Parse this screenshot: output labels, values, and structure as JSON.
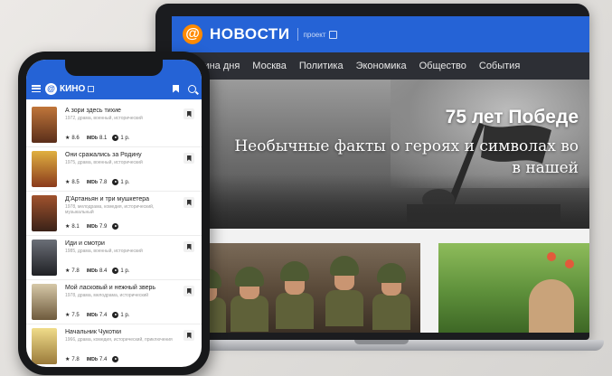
{
  "news": {
    "logo_symbol": "@",
    "title": "НОВОСТИ",
    "project_label": "проект",
    "nav": [
      "Картина дня",
      "Москва",
      "Политика",
      "Экономика",
      "Общество",
      "События"
    ],
    "hero_title": "75 лет Победе",
    "hero_subtitle_line1": "Необычные факты о героях и символах во",
    "hero_subtitle_line2": "в нашей",
    "colors": {
      "header": "#2563d6",
      "nav": "#2d2f35",
      "logo": "#ff8a00"
    }
  },
  "kino": {
    "logo_symbol": "@",
    "title": "КИНО",
    "header_icons": [
      "menu-icon",
      "bookmark-icon",
      "search-icon"
    ],
    "imdb_label": "IMDb",
    "movies": [
      {
        "title": "А зори здесь тихие",
        "meta": "1972, драма, военный, исторический",
        "rating": "8.6",
        "imdb": "8.1",
        "seasons": "1 р.",
        "poster_color": "#8a4b2a"
      },
      {
        "title": "Они сражались за Родину",
        "meta": "1975, драма, военный, исторический",
        "rating": "8.5",
        "imdb": "7.8",
        "seasons": "1 р.",
        "poster_color": "#c8922c"
      },
      {
        "title": "Д'Артаньян и три мушкетера",
        "meta": "1978, мелодрама, комедия, исторический, музыкальный",
        "rating": "8.1",
        "imdb": "7.9",
        "seasons": "",
        "poster_color": "#6a3a2a"
      },
      {
        "title": "Иди и смотри",
        "meta": "1985, драма, военный, исторический",
        "rating": "7.8",
        "imdb": "8.4",
        "seasons": "1 р.",
        "poster_color": "#3d3f44"
      },
      {
        "title": "Мой ласковый и нежный зверь",
        "meta": "1978, драма, мелодрама, исторический",
        "rating": "7.5",
        "imdb": "7.4",
        "seasons": "1 р.",
        "poster_color": "#9b8a6a"
      },
      {
        "title": "Начальник Чукотки",
        "meta": "1966, драма, комедия, исторический, приключения",
        "rating": "7.8",
        "imdb": "7.4",
        "seasons": "",
        "poster_color": "#d9c47a"
      }
    ]
  }
}
